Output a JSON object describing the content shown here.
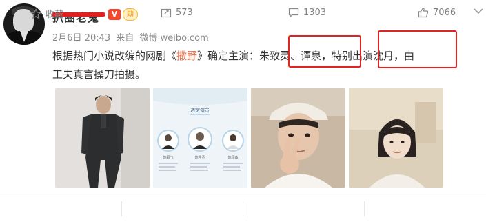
{
  "post": {
    "author": {
      "name": "扒圈老鬼",
      "vip_badge": "V",
      "medal_badge": "勋"
    },
    "meta": {
      "date": "2月6日 20:43",
      "source_prefix": "来自",
      "source": "微博 weibo.com"
    },
    "text": {
      "line1_a": "根据热门小说改编的网剧《",
      "title": "撒野",
      "line1_b": "》确定主演：朱致灵、谭泉，特别出演沈月，由",
      "line2": "工夫真言操刀拍摄。"
    },
    "poster": {
      "title": "选定演员",
      "roles": [
        "饰顾飞",
        "饰蒋丞",
        "饰顾淼"
      ]
    }
  },
  "actions": {
    "favorite": "收藏",
    "repost_count": "573",
    "comment_count": "1303",
    "like_count": "7066"
  },
  "colors": {
    "link": "#eb7350",
    "highlight_box": "#e42222",
    "strike": "#e02020",
    "muted": "#808080"
  }
}
